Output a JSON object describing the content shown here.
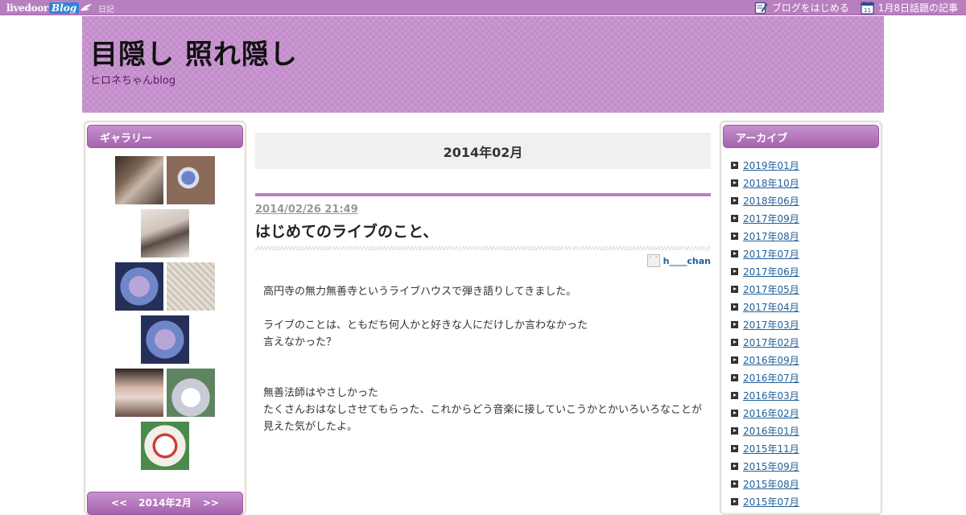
{
  "topbar": {
    "logo_livedoor": "livedoor",
    "logo_blog": "Blog",
    "diary_link": "日記",
    "start_blog": "ブログをはじめる",
    "trending": "1月8日話題の記事"
  },
  "header": {
    "title": "目隠し 照れ隠し",
    "description": "ヒロネちゃんblog"
  },
  "gallery": {
    "heading": "ギャラリー"
  },
  "calendar": {
    "prev": "<<",
    "label": "2014年2月",
    "next": ">>"
  },
  "archive": {
    "heading": "アーカイブ",
    "items": [
      "2019年01月",
      "2018年10月",
      "2018年06月",
      "2017年09月",
      "2017年08月",
      "2017年07月",
      "2017年06月",
      "2017年05月",
      "2017年04月",
      "2017年03月",
      "2017年02月",
      "2016年09月",
      "2016年07月",
      "2016年03月",
      "2016年02月",
      "2016年01月",
      "2015年11月",
      "2015年09月",
      "2015年08月",
      "2015年07月"
    ]
  },
  "main": {
    "month_heading": "2014年02月",
    "post": {
      "date": "2014/02/26 21:49",
      "title": "はじめてのライブのこと、",
      "author": "h____chan",
      "body": [
        "高円寺の無力無善寺というライブハウスで弾き語りしてきました。",
        "",
        "ライブのことは、ともだち何人かと好きな人にだけしか言わなかった",
        "言えなかった？",
        "",
        "",
        "無善法師はやさしかった",
        "たくさんおはなしさせてもらった、これからどう音楽に接していこうかとかいろいろなことが見えた気がしたよ。"
      ]
    }
  },
  "colors": {
    "accent": "#b87fbf",
    "header_bg": "#c38ccb",
    "link": "#1f5f99"
  }
}
